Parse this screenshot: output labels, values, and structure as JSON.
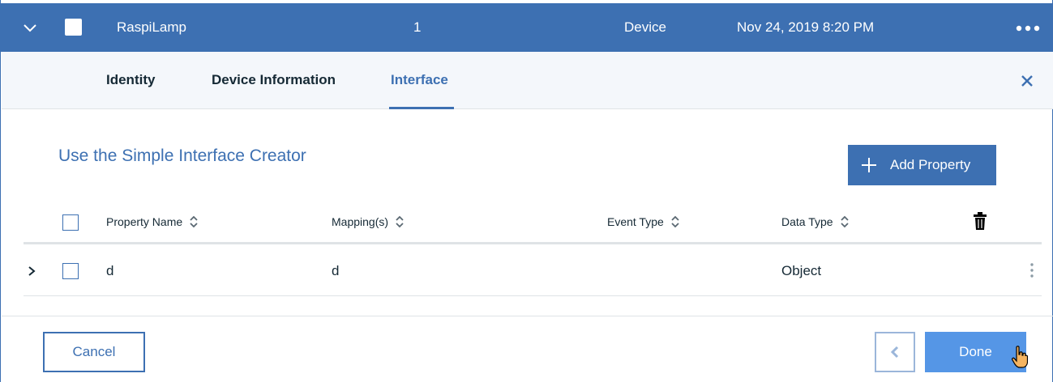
{
  "header": {
    "device_name": "RaspiLamp",
    "count": "1",
    "type": "Device",
    "timestamp": "Nov 24, 2019 8:20 PM",
    "icons": {
      "expand": "chevron-down-icon",
      "more": "overflow-menu-icon"
    }
  },
  "tabs": [
    {
      "label": "Identity",
      "active": false
    },
    {
      "label": "Device Information",
      "active": false
    },
    {
      "label": "Interface",
      "active": true
    }
  ],
  "section": {
    "title": "Use the Simple Interface Creator",
    "add_button": "Add Property"
  },
  "table": {
    "columns": [
      "Property Name",
      "Mapping(s)",
      "Event Type",
      "Data Type"
    ],
    "rows": [
      {
        "property_name": "d",
        "mappings": "d",
        "event_type": "",
        "data_type": "Object"
      }
    ]
  },
  "footer": {
    "cancel": "Cancel",
    "done": "Done"
  },
  "colors": {
    "primary": "#3d70b2",
    "done_button": "#5596e6",
    "tabs_bg": "#f4f7fb",
    "divider": "#dfe3e6"
  }
}
